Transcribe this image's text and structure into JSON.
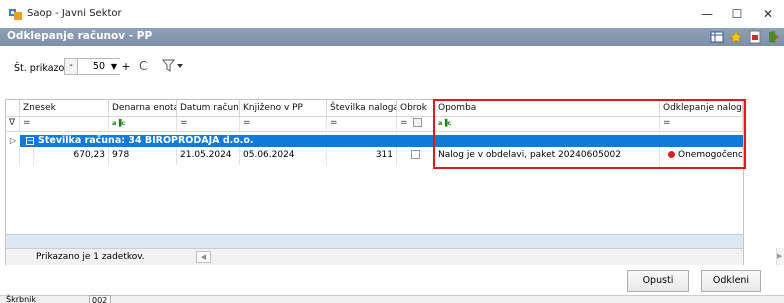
{
  "window": {
    "title": "Saop - Javni Sektor",
    "minimize": "—",
    "maximize": "☐",
    "close": "✕"
  },
  "header": {
    "title": "Odklepanje računov - PP"
  },
  "toolbar": {
    "page_size_label": "Št. prikazov",
    "minus": "-",
    "page_size_value": "50",
    "dropdown_arrow": "▼",
    "plus": "+",
    "refresh": "C"
  },
  "grid": {
    "columns": [
      "Znesek",
      "Denarna enota",
      "Datum računa",
      "Knjiženo v PP",
      "Številka naloga",
      "Obrok",
      "Opomba",
      "Odklepanje naloga"
    ],
    "filter": {
      "marker": "∇",
      "eq": "=",
      "abc": "a▐c"
    },
    "group": {
      "expand": "▷",
      "collapse": "−",
      "label": "Številka računa: 34 BIROPRODAJA d.o.o."
    },
    "row": {
      "znesek": "670,23",
      "denarna_enota": "978",
      "datum_racuna": "21.05.2024",
      "knjizeno_v_pp": "05.06.2024",
      "stevilka_naloga": "311",
      "opomba": "Nalog je v obdelavi, paket 20240605002",
      "odklepanje": "Onemogočeno"
    },
    "record_count": "Prikazano je 1 zadetkov.",
    "scroll_left": "◀",
    "scroll_right": "▶"
  },
  "buttons": {
    "cancel": "Opusti",
    "unlock": "Odkleni"
  },
  "footer": {
    "label": "Škrbnik",
    "value": "002"
  },
  "colors": {
    "header_bg": "#8a9cb4",
    "group_bg": "#0f7ad7",
    "highlight": "#e01a1a",
    "status_red": "#d42424"
  }
}
